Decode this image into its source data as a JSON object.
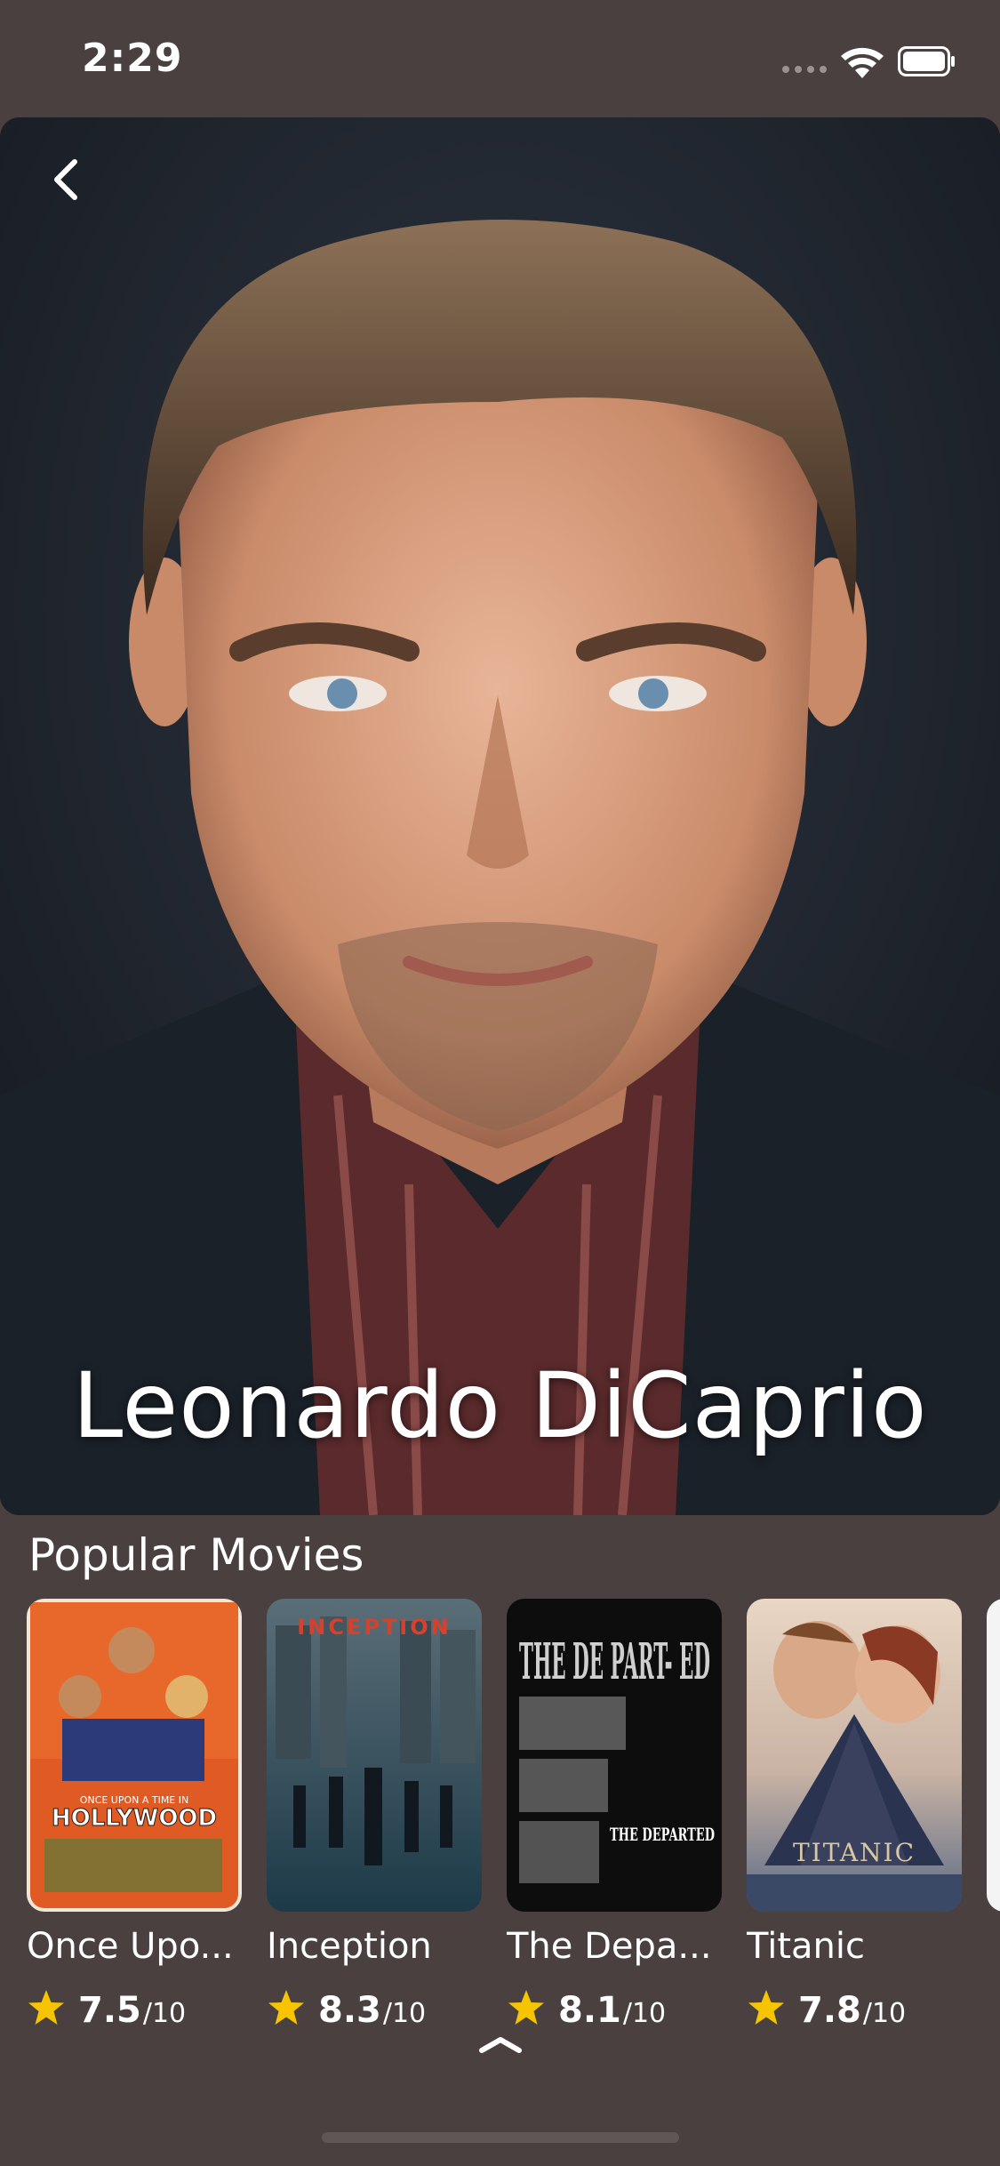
{
  "status": {
    "time": "2:29"
  },
  "actor": {
    "name": "Leonardo DiCaprio"
  },
  "section": {
    "title": "Popular Movies"
  },
  "movies": [
    {
      "title": "Once Upo...",
      "rating": "7.5",
      "max": "/10"
    },
    {
      "title": "Inception",
      "rating": "8.3",
      "max": "/10"
    },
    {
      "title": "The Depa...",
      "rating": "8.1",
      "max": "/10"
    },
    {
      "title": "Titanic",
      "rating": "7.8",
      "max": "/10"
    }
  ],
  "posters": {
    "inception_word": "INCEPTION",
    "departed_word": "THE DE PART- ED",
    "departed_small": "THE DEPARTED",
    "titanic_word": "TITANIC",
    "hollywood_word": "HOLLYWOOD",
    "hollywood_small": "ONCE UPON A TIME IN"
  },
  "colors": {
    "background": "#4a4040",
    "star": "#f6c400",
    "text": "#ffffff"
  }
}
